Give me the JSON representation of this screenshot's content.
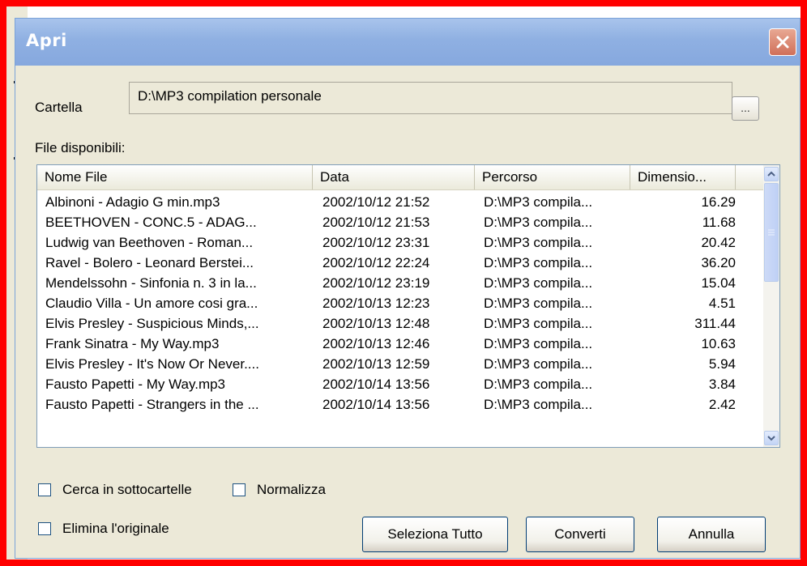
{
  "dialog": {
    "title": "Apri",
    "close_glyph": "✕"
  },
  "folder": {
    "label": "Cartella",
    "value": "D:\\MP3 compilation personale",
    "browse_label": "..."
  },
  "files_label": "File disponibili:",
  "columns": [
    "Nome File",
    "Data",
    "Percorso",
    "Dimensio..."
  ],
  "rows": [
    {
      "name": "Albinoni - Adagio G min.mp3",
      "date": "2002/10/12 21:52",
      "path": "D:\\MP3 compila...",
      "size": "16.29"
    },
    {
      "name": "BEETHOVEN - CONC.5 - ADAG...",
      "date": "2002/10/12 21:53",
      "path": "D:\\MP3 compila...",
      "size": "11.68"
    },
    {
      "name": "Ludwig van Beethoven - Roman...",
      "date": "2002/10/12 23:31",
      "path": "D:\\MP3 compila...",
      "size": "20.42"
    },
    {
      "name": "Ravel - Bolero - Leonard Berstei...",
      "date": "2002/10/12 22:24",
      "path": "D:\\MP3 compila...",
      "size": "36.20"
    },
    {
      "name": "Mendelssohn - Sinfonia n. 3 in la...",
      "date": "2002/10/12 23:19",
      "path": "D:\\MP3 compila...",
      "size": "15.04"
    },
    {
      "name": "Claudio Villa - Un amore cosi gra...",
      "date": "2002/10/13 12:23",
      "path": "D:\\MP3 compila...",
      "size": "4.51"
    },
    {
      "name": "Elvis Presley - Suspicious Minds,...",
      "date": "2002/10/13 12:48",
      "path": "D:\\MP3 compila...",
      "size": "311.44"
    },
    {
      "name": "Frank Sinatra - My Way.mp3",
      "date": "2002/10/13 12:46",
      "path": "D:\\MP3 compila...",
      "size": "10.63"
    },
    {
      "name": "Elvis Presley - It's Now Or Never....",
      "date": "2002/10/13 12:59",
      "path": "D:\\MP3 compila...",
      "size": "5.94"
    },
    {
      "name": "Fausto Papetti - My Way.mp3",
      "date": "2002/10/14 13:56",
      "path": "D:\\MP3 compila...",
      "size": "3.84"
    },
    {
      "name": "Fausto Papetti - Strangers in the ...",
      "date": "2002/10/14 13:56",
      "path": "D:\\MP3 compila...",
      "size": "2.42"
    }
  ],
  "options": {
    "subfolders_label": "Cerca in sottocartelle",
    "normalize_label": "Normalizza",
    "delete_original_label": "Elimina l'originale"
  },
  "buttons": {
    "select_all": "Seleziona Tutto",
    "convert": "Converti",
    "cancel": "Annulla"
  },
  "colors": {
    "titlebar": "#8fb0e2",
    "close_button": "#d0705a",
    "frame_highlight": "#ff0000",
    "dialog_bg": "#ece9d8"
  },
  "icons": {
    "close": "close-icon",
    "scroll_up": "chevron-up-icon",
    "scroll_down": "chevron-down-icon"
  }
}
